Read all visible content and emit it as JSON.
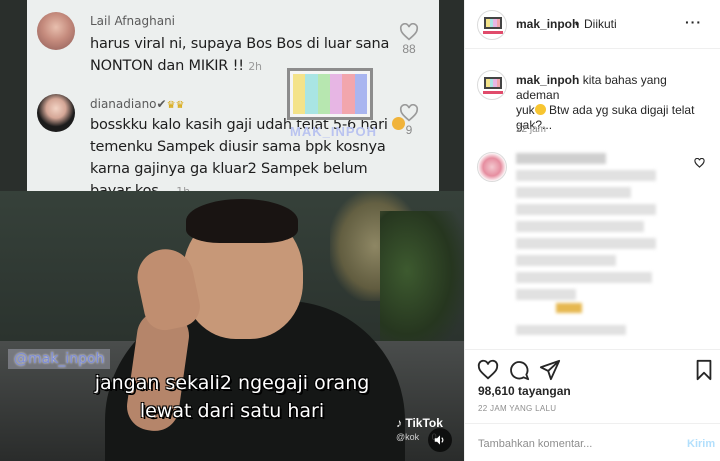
{
  "comments": [
    {
      "user": "Lail Afnaghani",
      "badge": "",
      "lines": [
        "harus viral ni, supaya Bos Bos di luar sana",
        "NONTON dan MIKIR !!"
      ],
      "time": "2h",
      "likes": "88"
    },
    {
      "user": "dianadiano",
      "badge": "✔",
      "lines": [
        "bosskku kalo kasih gaji udah telat 5-6 hari",
        "temenku Sampek diusir sama bpk kosnya",
        "karna gajinya ga kluar2 Sampek belum",
        "bayar kos..."
      ],
      "time": "1h",
      "likes": "9"
    }
  ],
  "watermark": "MAK_INPOH",
  "video": {
    "tag": "@mak_inpoh",
    "subtitle_1": "jangan sekali2 ngegaji orang",
    "subtitle_2": "lewat dari satu hari",
    "tiktok_label": "TikTok",
    "tiktok_handle": "@kok",
    "tiktok_suffix": "0"
  },
  "post": {
    "username": "mak_inpoh",
    "dot": "•",
    "follow_status": "Diikuti",
    "more": "···",
    "caption_user": "mak_inpoh",
    "caption_1": "kita bahas yang ademan",
    "caption_2": "yuk",
    "caption_3": " Btw ada yg suka digaji telat",
    "caption_4": "gak?...",
    "caption_time": "22 jam",
    "views": "98,610 tayangan",
    "ago": "22 JAM YANG LALU",
    "comment_placeholder": "Tambahkan komentar...",
    "send_label": "Kirim"
  },
  "colors": {
    "testcard": [
      "#f4e38a",
      "#a9e5e4",
      "#b7e7b0",
      "#e7b6e4",
      "#f2a6ad",
      "#a9b5f0"
    ]
  }
}
